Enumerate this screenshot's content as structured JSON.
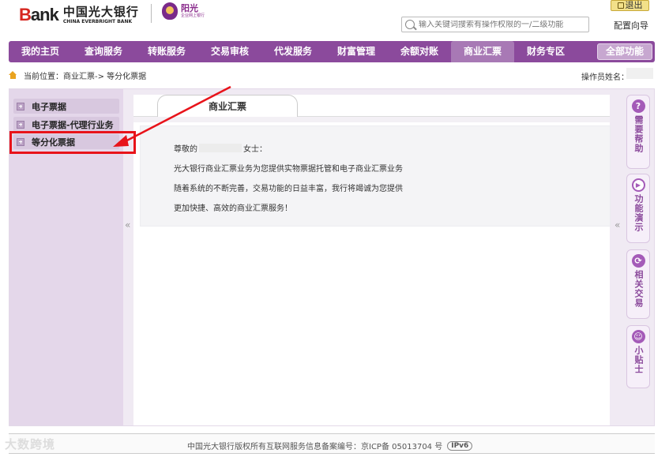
{
  "header": {
    "logo_b": "B",
    "logo_ank": "ank",
    "logo_cn": "中国光大银行",
    "logo_en": "CHINA EVERBRIGHT BANK",
    "sublogo_title": "阳光",
    "sublogo_sub": "企业网上银行",
    "logout_label": "退出",
    "search_placeholder": "输入关键词搜索有操作权限的一/二级功能",
    "config_label": "配置向导"
  },
  "nav": {
    "items": [
      {
        "label": "我的主页"
      },
      {
        "label": "查询服务"
      },
      {
        "label": "转账服务"
      },
      {
        "label": "交易审核"
      },
      {
        "label": "代发服务"
      },
      {
        "label": "财富管理"
      },
      {
        "label": "余额对账"
      },
      {
        "label": "商业汇票",
        "active": true
      },
      {
        "label": "财务专区"
      }
    ],
    "all_label": "全部功能"
  },
  "breadcrumb": {
    "prefix": "当前位置：",
    "path": "商业汇票-> 等分化票据"
  },
  "operator_label": "操作员姓名：",
  "sidebar": {
    "items": [
      {
        "label": "电子票据"
      },
      {
        "label": "电子票据-代理行业务"
      },
      {
        "label": "等分化票据"
      }
    ]
  },
  "content": {
    "tab_label": "商业汇票",
    "greeting_prefix": "尊敬的",
    "greeting_suffix": "女士：",
    "lines": [
      "光大银行商业汇票业务为您提供实物票据托管和电子商业汇票业务",
      "随着系统的不断完善，交易功能的日益丰富，我行将竭诚为您提供",
      "更加快捷、高效的商业汇票服务！"
    ]
  },
  "collapse_glyph": "«",
  "rail": {
    "items": [
      {
        "icon": "?",
        "label": "需要帮助"
      },
      {
        "icon": "▶",
        "label": "功能演示"
      },
      {
        "icon": "⟳",
        "label": "相关交易"
      },
      {
        "icon": "☺",
        "label": "小贴士"
      }
    ]
  },
  "footer": {
    "text": "中国光大银行版权所有互联网服务信息备案编号：京ICP备 05013704 号",
    "ipv6": "IPv6"
  },
  "watermark": "大数跨境",
  "colors": {
    "nav": "#8b4a9c",
    "accent": "#a45bb8",
    "annotation": "#e8131a",
    "brand_red": "#d6261f"
  }
}
